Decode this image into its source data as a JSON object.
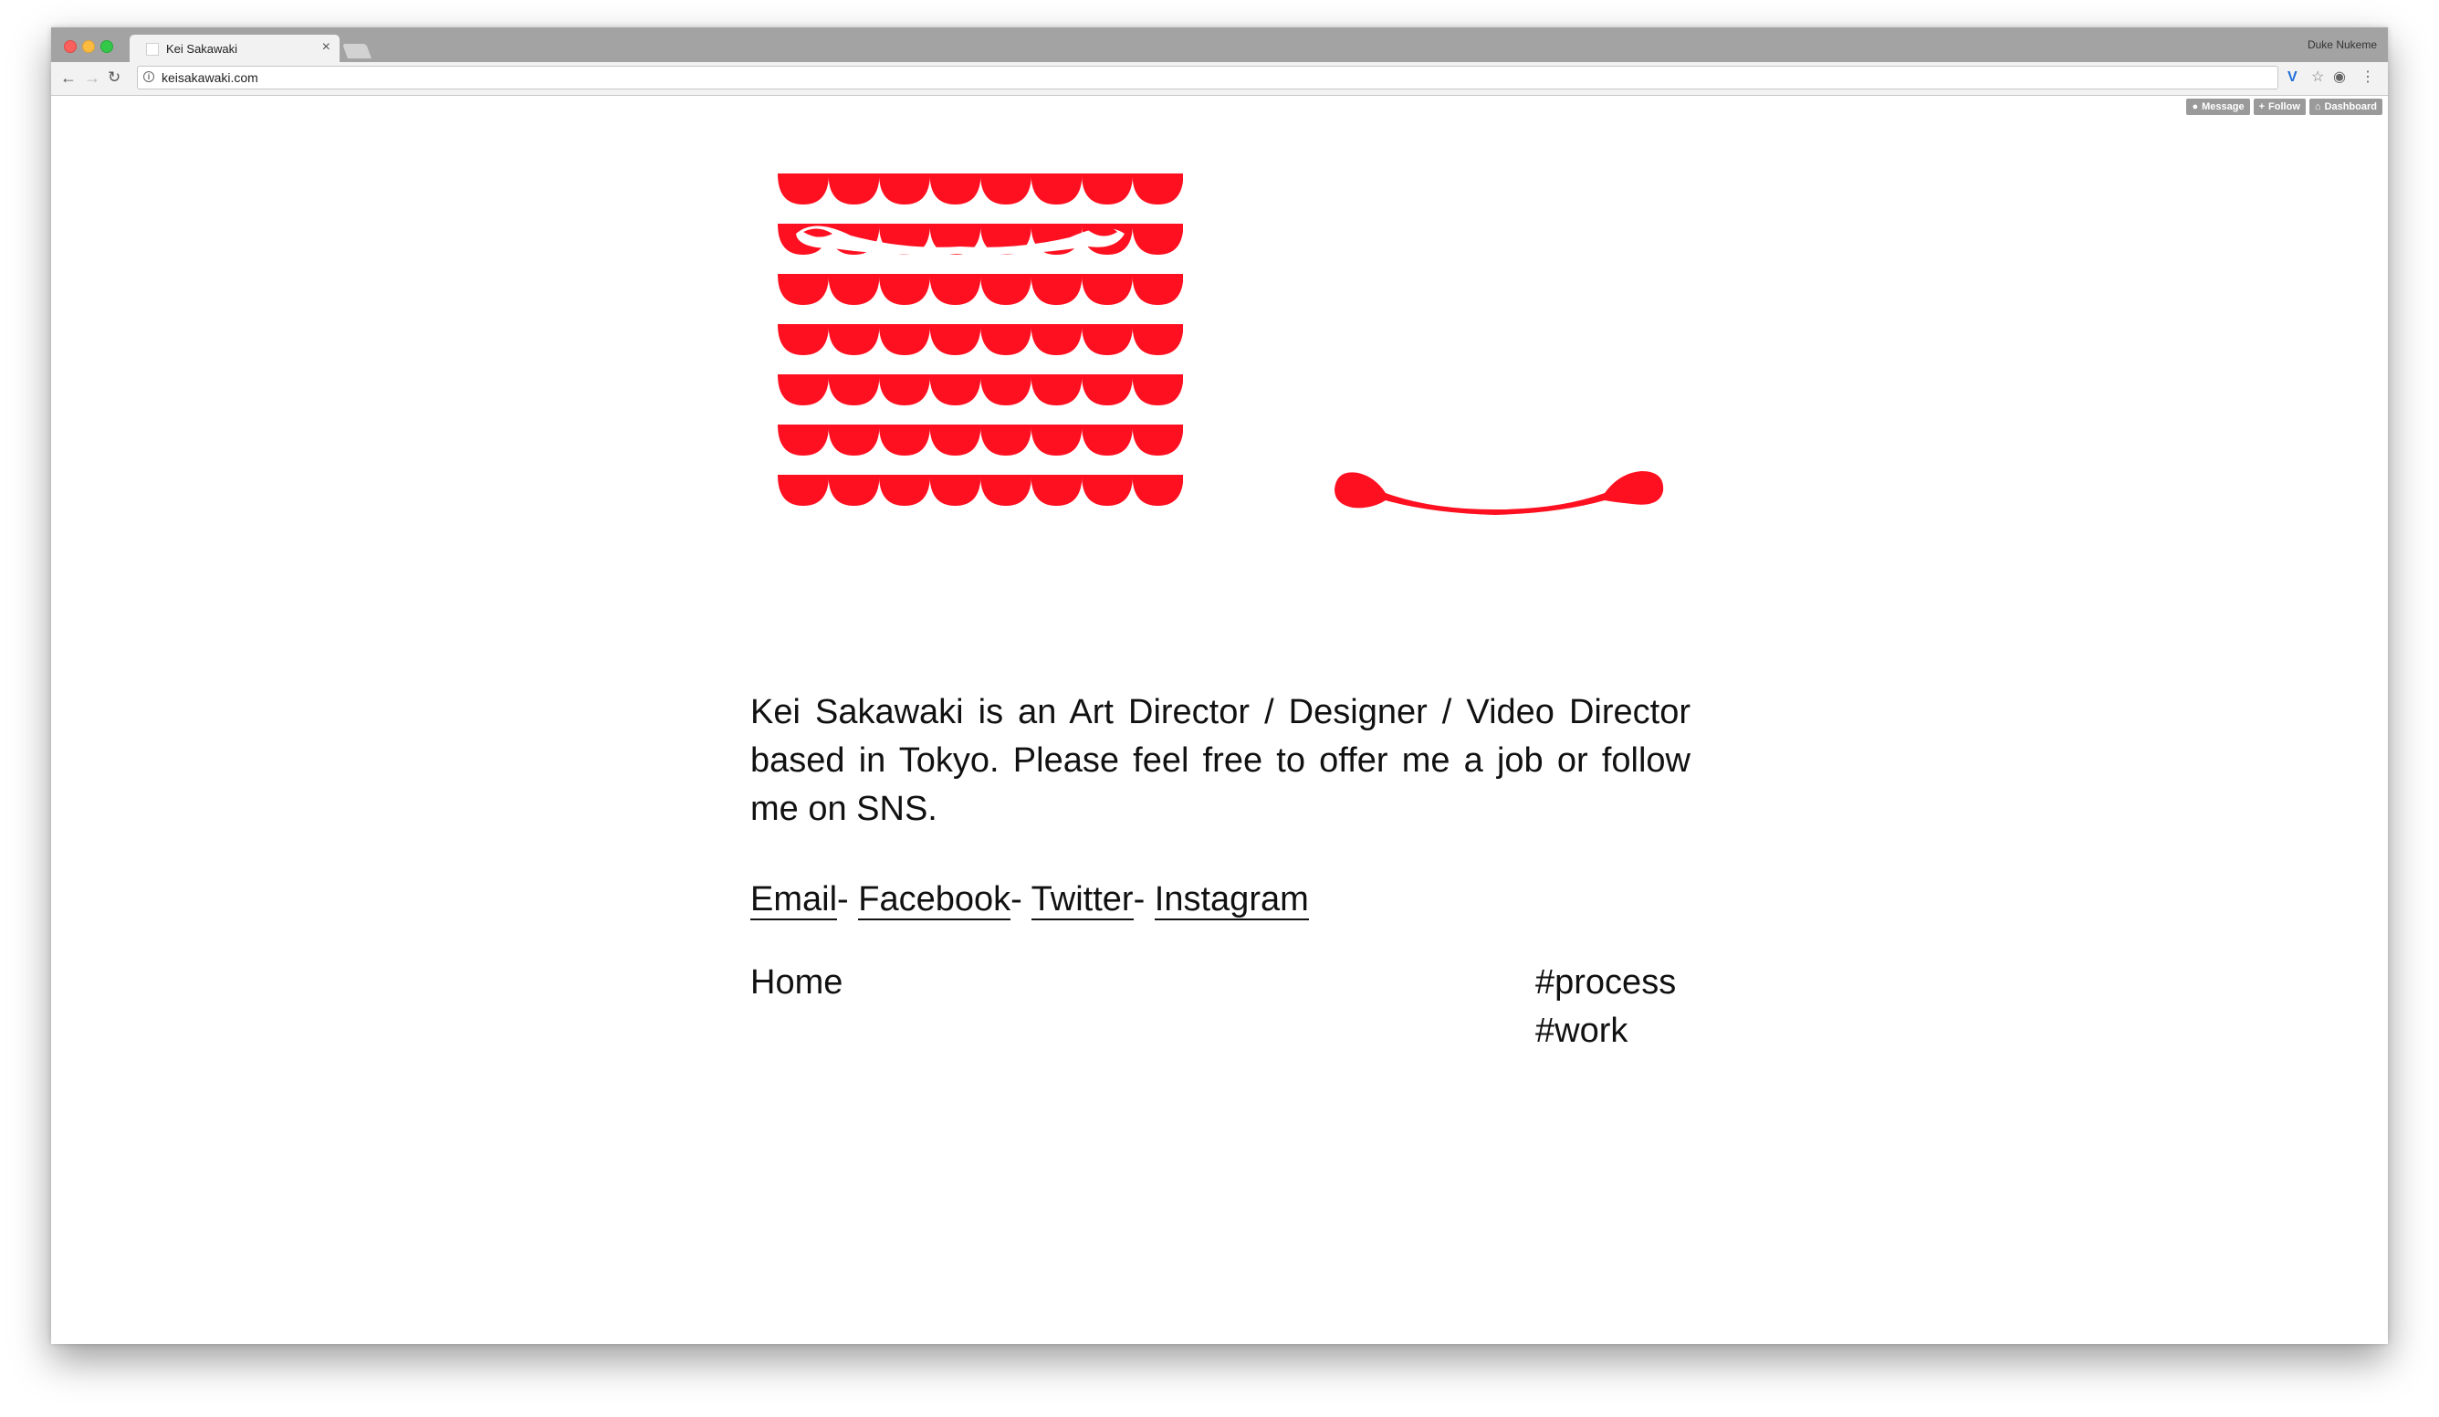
{
  "browser": {
    "tab_title": "Kei Sakawaki",
    "tab_close": "×",
    "url": "keisakawaki.com",
    "profile_name": "Duke Nukeme"
  },
  "tumblr_controls": {
    "message": "Message",
    "follow": "Follow",
    "dashboard": "Dashboard"
  },
  "page": {
    "bio": "Kei Sakawaki is an Art Director / Designer / Video Director based in Tokyo. Please feel free to offer me a job or follow me on SNS.",
    "links": [
      {
        "label": "Email",
        "sep": "- "
      },
      {
        "label": "Facebook",
        "sep": "- "
      },
      {
        "label": "Twitter",
        "sep": "- "
      },
      {
        "label": "Instagram",
        "sep": ""
      }
    ],
    "home_label": "Home",
    "tags": [
      "#process",
      "#work"
    ]
  },
  "colors": {
    "accent_red": "#ff1020"
  }
}
